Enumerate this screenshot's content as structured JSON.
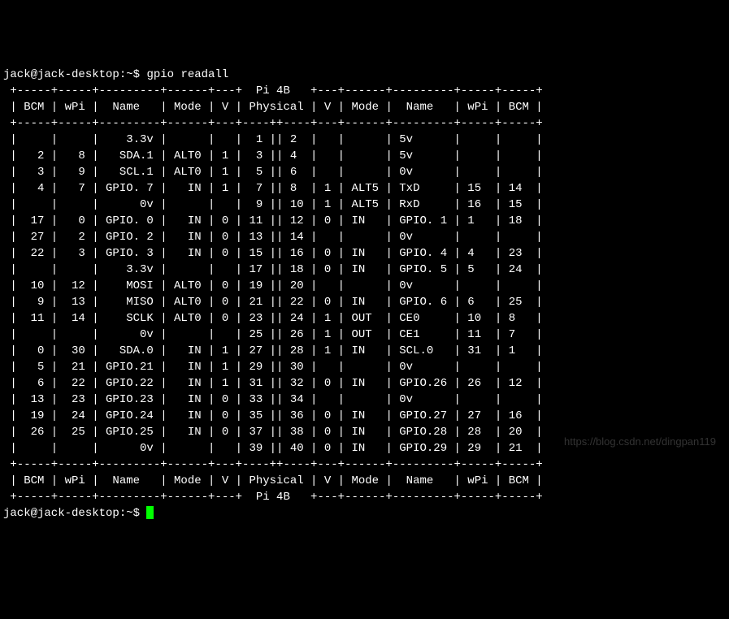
{
  "prompt1": "jack@jack-desktop:~$ ",
  "command": "gpio readall",
  "prompt2": "jack@jack-desktop:~$ ",
  "watermark": "https://blog.csdn.net/dingpan119",
  "table": {
    "title": "Pi 4B",
    "headers_left": [
      "BCM",
      "wPi",
      "Name",
      "Mode",
      "V"
    ],
    "headers_mid": "Physical",
    "headers_right": [
      "V",
      "Mode",
      "Name",
      "wPi",
      "BCM"
    ],
    "rows": [
      {
        "l": {
          "bcm": "",
          "wpi": "",
          "name": "3.3v",
          "mode": "",
          "v": ""
        },
        "phys": [
          1,
          2
        ],
        "r": {
          "v": "",
          "mode": "",
          "name": "5v",
          "wpi": "",
          "bcm": ""
        }
      },
      {
        "l": {
          "bcm": "2",
          "wpi": "8",
          "name": "SDA.1",
          "mode": "ALT0",
          "v": "1"
        },
        "phys": [
          3,
          4
        ],
        "r": {
          "v": "",
          "mode": "",
          "name": "5v",
          "wpi": "",
          "bcm": ""
        }
      },
      {
        "l": {
          "bcm": "3",
          "wpi": "9",
          "name": "SCL.1",
          "mode": "ALT0",
          "v": "1"
        },
        "phys": [
          5,
          6
        ],
        "r": {
          "v": "",
          "mode": "",
          "name": "0v",
          "wpi": "",
          "bcm": ""
        }
      },
      {
        "l": {
          "bcm": "4",
          "wpi": "7",
          "name": "GPIO. 7",
          "mode": "IN",
          "v": "1"
        },
        "phys": [
          7,
          8
        ],
        "r": {
          "v": "1",
          "mode": "ALT5",
          "name": "TxD",
          "wpi": "15",
          "bcm": "14"
        }
      },
      {
        "l": {
          "bcm": "",
          "wpi": "",
          "name": "0v",
          "mode": "",
          "v": ""
        },
        "phys": [
          9,
          10
        ],
        "r": {
          "v": "1",
          "mode": "ALT5",
          "name": "RxD",
          "wpi": "16",
          "bcm": "15"
        }
      },
      {
        "l": {
          "bcm": "17",
          "wpi": "0",
          "name": "GPIO. 0",
          "mode": "IN",
          "v": "0"
        },
        "phys": [
          11,
          12
        ],
        "r": {
          "v": "0",
          "mode": "IN",
          "name": "GPIO. 1",
          "wpi": "1",
          "bcm": "18"
        }
      },
      {
        "l": {
          "bcm": "27",
          "wpi": "2",
          "name": "GPIO. 2",
          "mode": "IN",
          "v": "0"
        },
        "phys": [
          13,
          14
        ],
        "r": {
          "v": "",
          "mode": "",
          "name": "0v",
          "wpi": "",
          "bcm": ""
        }
      },
      {
        "l": {
          "bcm": "22",
          "wpi": "3",
          "name": "GPIO. 3",
          "mode": "IN",
          "v": "0"
        },
        "phys": [
          15,
          16
        ],
        "r": {
          "v": "0",
          "mode": "IN",
          "name": "GPIO. 4",
          "wpi": "4",
          "bcm": "23"
        }
      },
      {
        "l": {
          "bcm": "",
          "wpi": "",
          "name": "3.3v",
          "mode": "",
          "v": ""
        },
        "phys": [
          17,
          18
        ],
        "r": {
          "v": "0",
          "mode": "IN",
          "name": "GPIO. 5",
          "wpi": "5",
          "bcm": "24"
        }
      },
      {
        "l": {
          "bcm": "10",
          "wpi": "12",
          "name": "MOSI",
          "mode": "ALT0",
          "v": "0"
        },
        "phys": [
          19,
          20
        ],
        "r": {
          "v": "",
          "mode": "",
          "name": "0v",
          "wpi": "",
          "bcm": ""
        }
      },
      {
        "l": {
          "bcm": "9",
          "wpi": "13",
          "name": "MISO",
          "mode": "ALT0",
          "v": "0"
        },
        "phys": [
          21,
          22
        ],
        "r": {
          "v": "0",
          "mode": "IN",
          "name": "GPIO. 6",
          "wpi": "6",
          "bcm": "25"
        }
      },
      {
        "l": {
          "bcm": "11",
          "wpi": "14",
          "name": "SCLK",
          "mode": "ALT0",
          "v": "0"
        },
        "phys": [
          23,
          24
        ],
        "r": {
          "v": "1",
          "mode": "OUT",
          "name": "CE0",
          "wpi": "10",
          "bcm": "8"
        }
      },
      {
        "l": {
          "bcm": "",
          "wpi": "",
          "name": "0v",
          "mode": "",
          "v": ""
        },
        "phys": [
          25,
          26
        ],
        "r": {
          "v": "1",
          "mode": "OUT",
          "name": "CE1",
          "wpi": "11",
          "bcm": "7"
        }
      },
      {
        "l": {
          "bcm": "0",
          "wpi": "30",
          "name": "SDA.0",
          "mode": "IN",
          "v": "1"
        },
        "phys": [
          27,
          28
        ],
        "r": {
          "v": "1",
          "mode": "IN",
          "name": "SCL.0",
          "wpi": "31",
          "bcm": "1"
        }
      },
      {
        "l": {
          "bcm": "5",
          "wpi": "21",
          "name": "GPIO.21",
          "mode": "IN",
          "v": "1"
        },
        "phys": [
          29,
          30
        ],
        "r": {
          "v": "",
          "mode": "",
          "name": "0v",
          "wpi": "",
          "bcm": ""
        }
      },
      {
        "l": {
          "bcm": "6",
          "wpi": "22",
          "name": "GPIO.22",
          "mode": "IN",
          "v": "1"
        },
        "phys": [
          31,
          32
        ],
        "r": {
          "v": "0",
          "mode": "IN",
          "name": "GPIO.26",
          "wpi": "26",
          "bcm": "12"
        }
      },
      {
        "l": {
          "bcm": "13",
          "wpi": "23",
          "name": "GPIO.23",
          "mode": "IN",
          "v": "0"
        },
        "phys": [
          33,
          34
        ],
        "r": {
          "v": "",
          "mode": "",
          "name": "0v",
          "wpi": "",
          "bcm": ""
        }
      },
      {
        "l": {
          "bcm": "19",
          "wpi": "24",
          "name": "GPIO.24",
          "mode": "IN",
          "v": "0"
        },
        "phys": [
          35,
          36
        ],
        "r": {
          "v": "0",
          "mode": "IN",
          "name": "GPIO.27",
          "wpi": "27",
          "bcm": "16"
        }
      },
      {
        "l": {
          "bcm": "26",
          "wpi": "25",
          "name": "GPIO.25",
          "mode": "IN",
          "v": "0"
        },
        "phys": [
          37,
          38
        ],
        "r": {
          "v": "0",
          "mode": "IN",
          "name": "GPIO.28",
          "wpi": "28",
          "bcm": "20"
        }
      },
      {
        "l": {
          "bcm": "",
          "wpi": "",
          "name": "0v",
          "mode": "",
          "v": ""
        },
        "phys": [
          39,
          40
        ],
        "r": {
          "v": "0",
          "mode": "IN",
          "name": "GPIO.29",
          "wpi": "29",
          "bcm": "21"
        }
      }
    ]
  },
  "chart_data": {
    "type": "table",
    "title": "Pi 4B GPIO readall",
    "columns": [
      "BCM_L",
      "wPi_L",
      "Name_L",
      "Mode_L",
      "V_L",
      "Phys_L",
      "Phys_R",
      "V_R",
      "Mode_R",
      "Name_R",
      "wPi_R",
      "BCM_R"
    ],
    "rows": [
      [
        "",
        "",
        "3.3v",
        "",
        "",
        1,
        2,
        "",
        "",
        "5v",
        "",
        ""
      ],
      [
        2,
        8,
        "SDA.1",
        "ALT0",
        1,
        3,
        4,
        "",
        "",
        "5v",
        "",
        ""
      ],
      [
        3,
        9,
        "SCL.1",
        "ALT0",
        1,
        5,
        6,
        "",
        "",
        "0v",
        "",
        ""
      ],
      [
        4,
        7,
        "GPIO. 7",
        "IN",
        1,
        7,
        8,
        1,
        "ALT5",
        "TxD",
        15,
        14
      ],
      [
        "",
        "",
        "0v",
        "",
        "",
        9,
        10,
        1,
        "ALT5",
        "RxD",
        16,
        15
      ],
      [
        17,
        0,
        "GPIO. 0",
        "IN",
        0,
        11,
        12,
        0,
        "IN",
        "GPIO. 1",
        1,
        18
      ],
      [
        27,
        2,
        "GPIO. 2",
        "IN",
        0,
        13,
        14,
        "",
        "",
        "0v",
        "",
        ""
      ],
      [
        22,
        3,
        "GPIO. 3",
        "IN",
        0,
        15,
        16,
        0,
        "IN",
        "GPIO. 4",
        4,
        23
      ],
      [
        "",
        "",
        "3.3v",
        "",
        "",
        17,
        18,
        0,
        "IN",
        "GPIO. 5",
        5,
        24
      ],
      [
        10,
        12,
        "MOSI",
        "ALT0",
        0,
        19,
        20,
        "",
        "",
        "0v",
        "",
        ""
      ],
      [
        9,
        13,
        "MISO",
        "ALT0",
        0,
        21,
        22,
        0,
        "IN",
        "GPIO. 6",
        6,
        25
      ],
      [
        11,
        14,
        "SCLK",
        "ALT0",
        0,
        23,
        24,
        1,
        "OUT",
        "CE0",
        10,
        8
      ],
      [
        "",
        "",
        "0v",
        "",
        "",
        25,
        26,
        1,
        "OUT",
        "CE1",
        11,
        7
      ],
      [
        0,
        30,
        "SDA.0",
        "IN",
        1,
        27,
        28,
        1,
        "IN",
        "SCL.0",
        31,
        1
      ],
      [
        5,
        21,
        "GPIO.21",
        "IN",
        1,
        29,
        30,
        "",
        "",
        "0v",
        "",
        ""
      ],
      [
        6,
        22,
        "GPIO.22",
        "IN",
        1,
        31,
        32,
        0,
        "IN",
        "GPIO.26",
        26,
        12
      ],
      [
        13,
        23,
        "GPIO.23",
        "IN",
        0,
        33,
        34,
        "",
        "",
        "0v",
        "",
        ""
      ],
      [
        19,
        24,
        "GPIO.24",
        "IN",
        0,
        35,
        36,
        0,
        "IN",
        "GPIO.27",
        27,
        16
      ],
      [
        26,
        25,
        "GPIO.25",
        "IN",
        0,
        37,
        38,
        0,
        "IN",
        "GPIO.28",
        28,
        20
      ],
      [
        "",
        "",
        "0v",
        "",
        "",
        39,
        40,
        0,
        "IN",
        "GPIO.29",
        29,
        21
      ]
    ]
  }
}
